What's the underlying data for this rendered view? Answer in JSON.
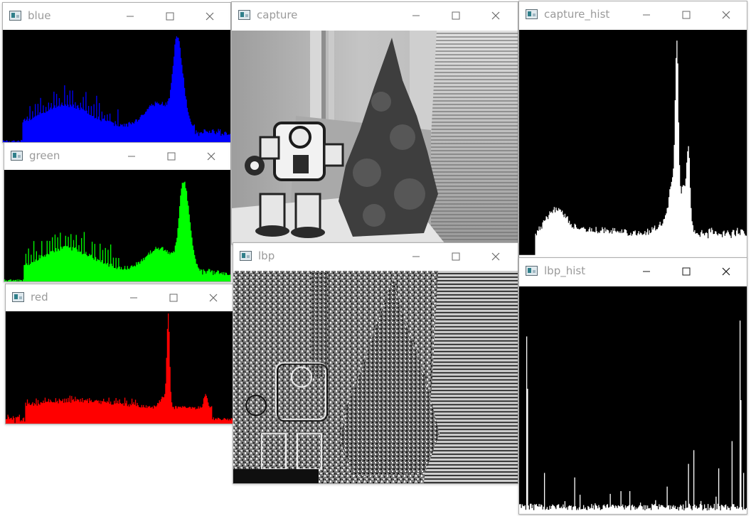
{
  "windows": {
    "blue": {
      "title": "blue",
      "color": "#0000ff"
    },
    "green": {
      "title": "green",
      "color": "#00ff00"
    },
    "red": {
      "title": "red",
      "color": "#ff0000"
    },
    "capture": {
      "title": "capture"
    },
    "capture_hist": {
      "title": "capture_hist",
      "color": "#ffffff"
    },
    "lbp": {
      "title": "lbp"
    },
    "lbp_hist": {
      "title": "lbp_hist",
      "color": "#ffffff"
    }
  },
  "icons": {
    "app": "opencv-window-icon",
    "minimize": "minimize-icon",
    "maximize": "maximize-icon",
    "close": "close-icon"
  }
}
